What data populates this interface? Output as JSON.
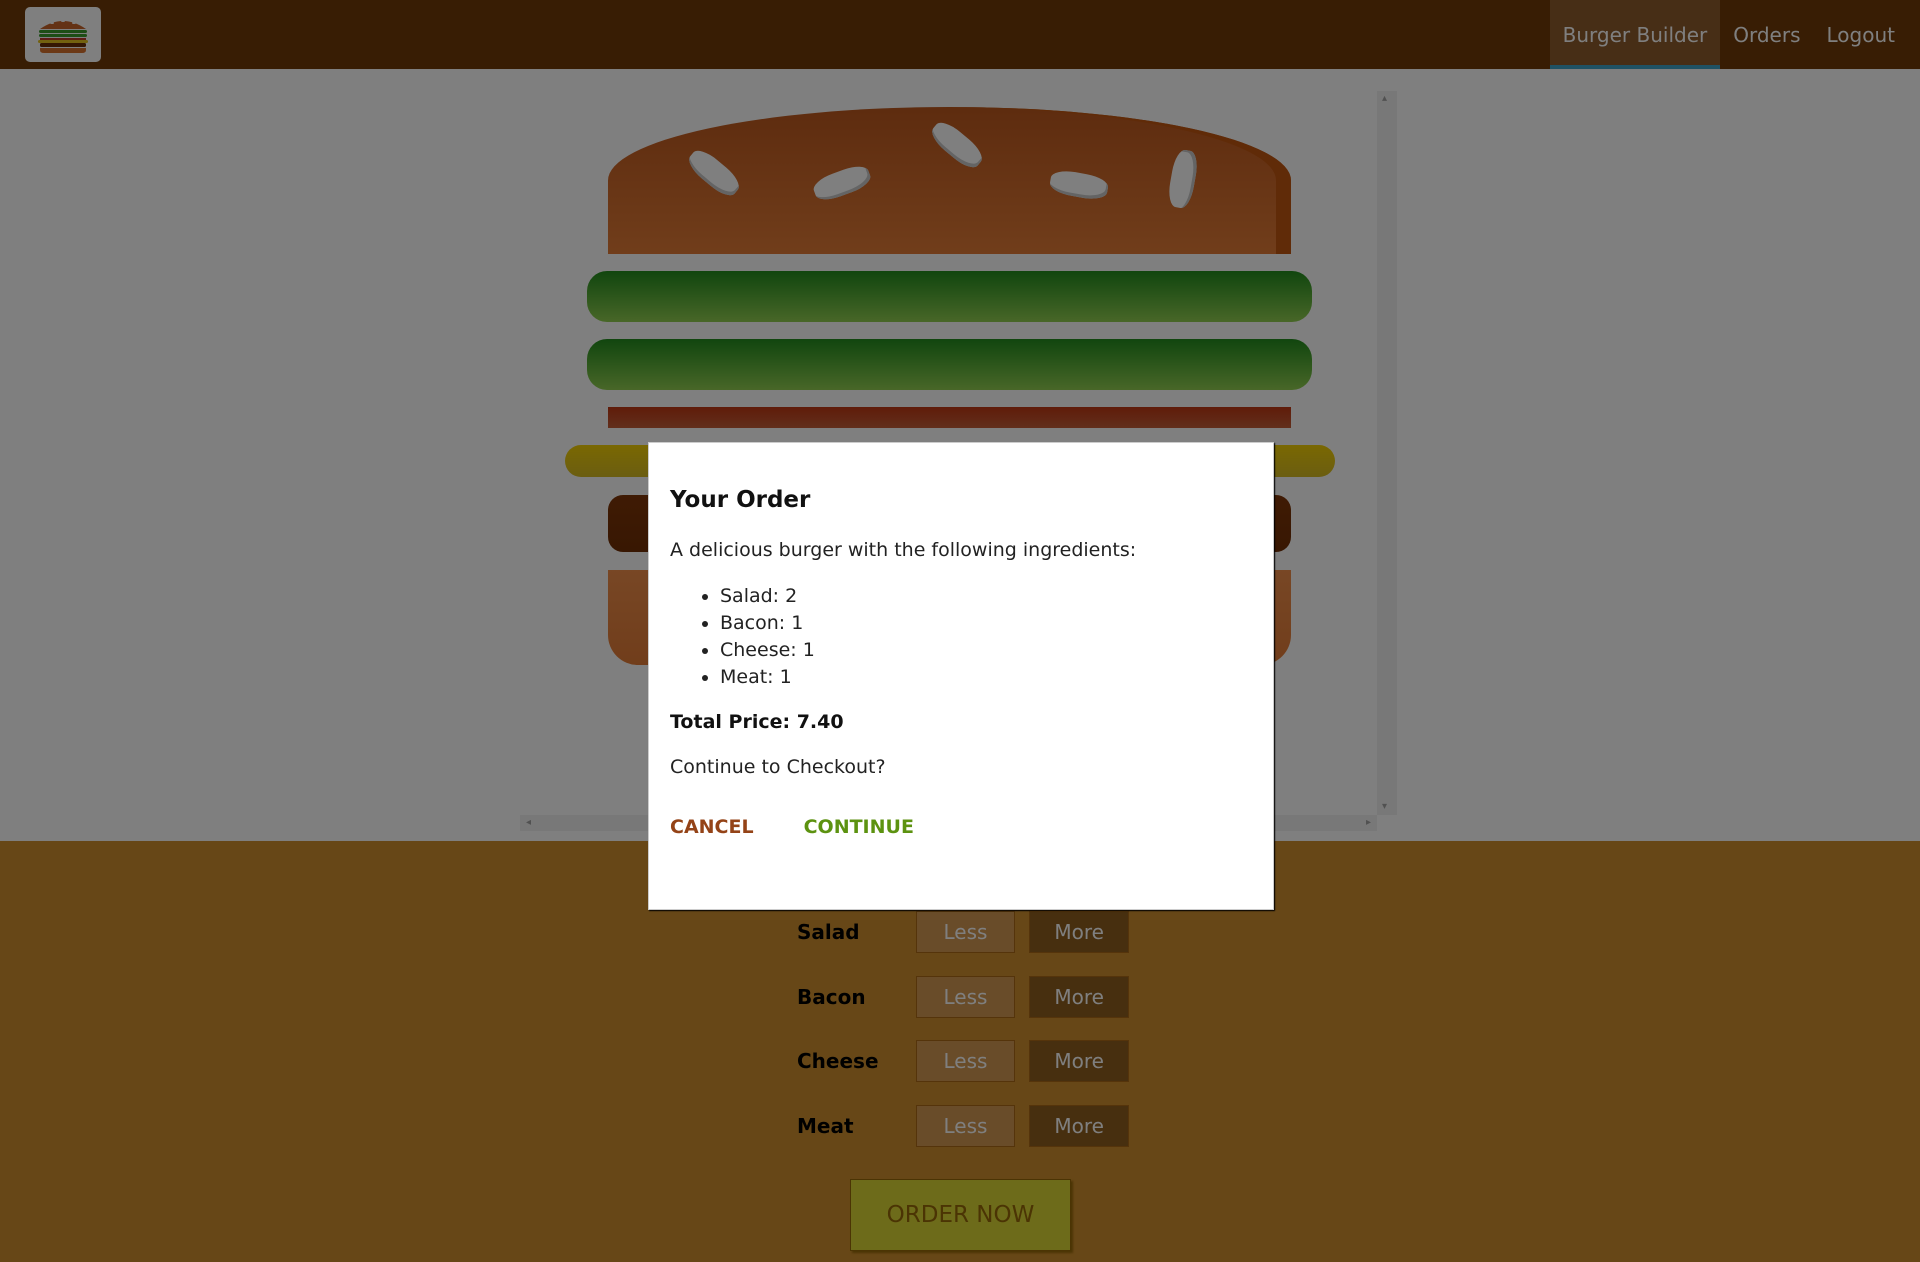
{
  "nav": {
    "items": [
      {
        "label": "Burger Builder",
        "active": true
      },
      {
        "label": "Orders",
        "active": false
      },
      {
        "label": "Logout",
        "active": false
      }
    ]
  },
  "controls": {
    "current_price": "",
    "items": [
      {
        "label": "Salad",
        "less": "Less",
        "more": "More"
      },
      {
        "label": "Bacon",
        "less": "Less",
        "more": "More"
      },
      {
        "label": "Cheese",
        "less": "Less",
        "more": "More"
      },
      {
        "label": "Meat",
        "less": "Less",
        "more": "More"
      }
    ],
    "order_label": "ORDER NOW"
  },
  "modal": {
    "title": "Your Order",
    "intro": "A delicious burger with the following ingredients:",
    "ingredients": [
      "Salad: 2",
      "Bacon: 1",
      "Cheese: 1",
      "Meat: 1"
    ],
    "total": "Total Price: 7.40",
    "question": "Continue to Checkout?",
    "cancel_label": "CANCEL",
    "continue_label": "CONTINUE"
  },
  "colors": {
    "toolbar": "#703b09",
    "controls_bg": "#cf8f2e",
    "order_button": "#dad735",
    "cancel": "#944317",
    "continue": "#5c9210",
    "nav_active_underline": "#40a4c8"
  }
}
